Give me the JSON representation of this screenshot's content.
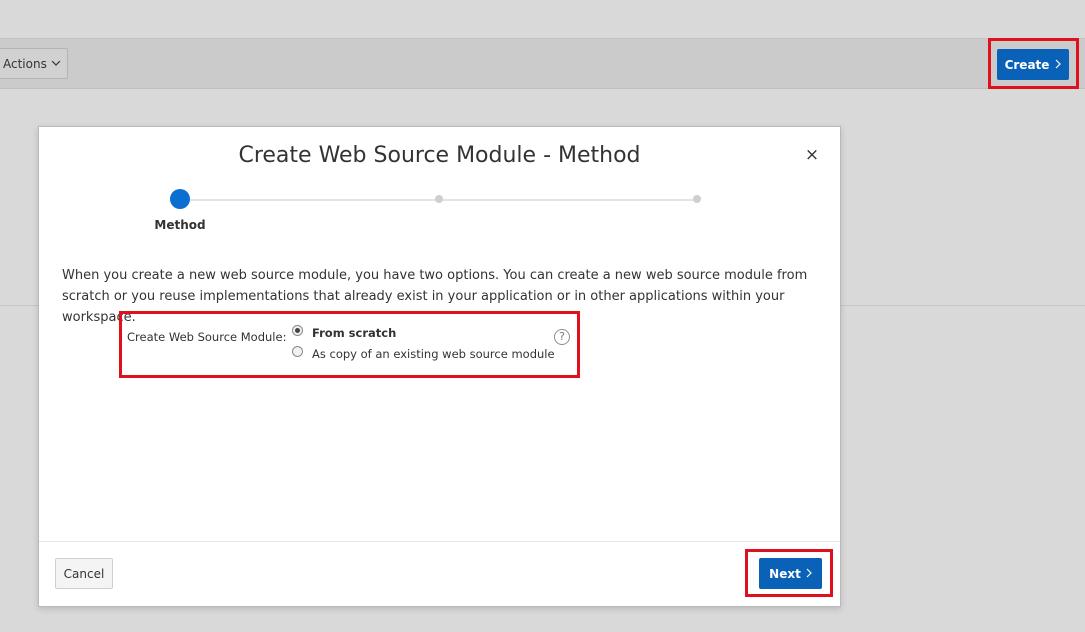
{
  "toolbar": {
    "actions_label": "Actions",
    "create_label": "Create"
  },
  "icons": {
    "actions_chevron": "chevron-down-icon",
    "create_chevron": "chevron-right-icon",
    "close": "close-icon",
    "help": "help-icon"
  },
  "dialog": {
    "title": "Create Web Source Module - Method",
    "close_glyph": "×",
    "wizard": {
      "steps": [
        "Method",
        "",
        ""
      ],
      "current_step": "Method"
    },
    "description": "When you create a new web source module, you have two options. You can create a new web source module from scratch or you reuse implementations that already exist in your application or in other applications within your workspace.",
    "field_label": "Create Web Source Module:",
    "options": [
      {
        "label": "From scratch",
        "selected": true
      },
      {
        "label": "As copy of an existing web source module",
        "selected": false
      }
    ],
    "help_glyph": "?",
    "cancel_label": "Cancel",
    "next_label": "Next"
  },
  "colors": {
    "primary": "#0a62b8",
    "highlight": "#e0111f",
    "step_active": "#0a6fd0"
  }
}
